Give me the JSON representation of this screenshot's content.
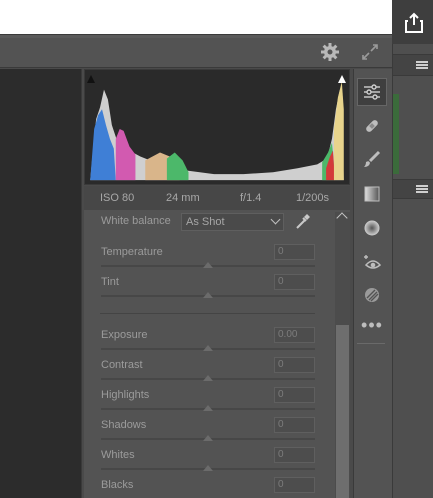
{
  "camera_info": {
    "iso": "ISO 80",
    "focal_length": "24 mm",
    "aperture": "f/1.4",
    "shutter": "1/200s"
  },
  "white_balance": {
    "label": "White balance",
    "value": "As Shot",
    "temperature_label": "Temperature",
    "temperature_value": "0",
    "tint_label": "Tint",
    "tint_value": "0"
  },
  "tone": {
    "exposure_label": "Exposure",
    "exposure_value": "0.00",
    "contrast_label": "Contrast",
    "contrast_value": "0",
    "highlights_label": "Highlights",
    "highlights_value": "0",
    "shadows_label": "Shadows",
    "shadows_value": "0",
    "whites_label": "Whites",
    "whites_value": "0",
    "blacks_label": "Blacks",
    "blacks_value": "0"
  },
  "icons": {
    "top": [
      "share-icon",
      "gear-icon",
      "expand-icon",
      "hamburger-menu-icon"
    ],
    "tools": [
      "edit-sliders-icon",
      "healing-bandage-icon",
      "brush-icon",
      "gradient-icon",
      "radial-filter-icon",
      "red-eye-icon",
      "presets-icon",
      "more-icon"
    ]
  },
  "colors": {
    "panel": "#535353",
    "histogram_bg": "#2a2a2a",
    "canvas": "#2c2c2c"
  }
}
